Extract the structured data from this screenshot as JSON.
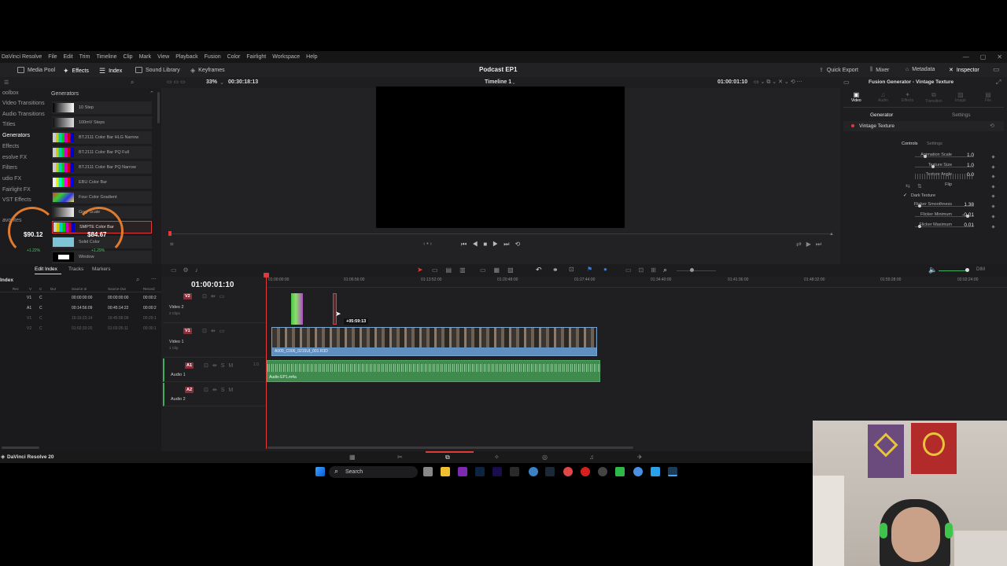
{
  "app": {
    "menu": [
      "DaVinci Resolve",
      "File",
      "Edit",
      "Trim",
      "Timeline",
      "Clip",
      "Mark",
      "View",
      "Playback",
      "Fusion",
      "Color",
      "Fairlight",
      "Workspace",
      "Help"
    ]
  },
  "toolbar": {
    "media_pool": "Media Pool",
    "effects": "Effects",
    "index": "Index",
    "sound_library": "Sound Library",
    "keyframes": "Keyframes",
    "project_title": "Podcast EP1",
    "quick_export": "Quick Export",
    "mixer": "Mixer",
    "metadata": "Metadata",
    "inspector": "Inspector"
  },
  "viewer_bar": {
    "zoom": "33%",
    "duration": "00:30:18:13",
    "timeline_name": "Timeline 1",
    "timecode": "01:00:01:10"
  },
  "effects_panel": {
    "toolbox": [
      "oolbox",
      "Video Transitions",
      "Audio Transitions",
      "Titles",
      "Generators",
      "Effects",
      "esolve FX",
      "Filters",
      "udio FX",
      "Fairlight FX",
      "VST Effects",
      "avorites"
    ],
    "header": "Generators",
    "items": [
      {
        "label": "10 Step"
      },
      {
        "label": "100mV Steps"
      },
      {
        "label": "BT.2111 Color Bar HLG Narrow"
      },
      {
        "label": "BT.2111 Color Bar PQ Full"
      },
      {
        "label": "BT.2111 Color Bar PQ Narrow"
      },
      {
        "label": "EBU Color Bar"
      },
      {
        "label": "Four Color Gradient"
      },
      {
        "label": "Grey Scale"
      },
      {
        "label": "SMPTE Color Bar"
      },
      {
        "label": "Solid Color"
      },
      {
        "label": "Window"
      }
    ]
  },
  "overlay": {
    "price_left": "$90.12",
    "price_right": "$84.67",
    "pct_left": "+1.22%",
    "pct_right": "+1.29%"
  },
  "inspector": {
    "title": "Fusion Generator - Vintage Texture",
    "tabs": [
      "Video",
      "Audio",
      "Effects",
      "Transition",
      "Image",
      "File"
    ],
    "subtabs": [
      "Generator",
      "Settings"
    ],
    "section": "Vintage Texture",
    "section_tabs": [
      "Controls",
      "Settings"
    ],
    "props": [
      {
        "label": "Animation Scale",
        "value": "1.0",
        "level": 0.15
      },
      {
        "label": "Texture Size",
        "value": "1.0",
        "level": 0.3
      },
      {
        "label": "Texture Angle",
        "value": "0.0",
        "level": 0.5
      },
      {
        "label": "Flip",
        "value": ""
      },
      {
        "label": "Dark Texture",
        "value": ""
      },
      {
        "label": "Flicker Smoothness",
        "value": "1.38",
        "level": 0.05
      },
      {
        "label": "Flicker Minimum",
        "value": "-0.01",
        "level": 0.92
      },
      {
        "label": "Flicker Maximum",
        "value": "0.01",
        "level": 0.05
      }
    ]
  },
  "index_panel": {
    "title": "Index",
    "tabs": [
      "Edit Index",
      "Tracks",
      "Markers"
    ],
    "columns": [
      "Rec",
      "V",
      "C",
      "Dur",
      "Source In",
      "Source Out",
      "Record"
    ],
    "rows": [
      {
        "track": "V1",
        "c": "C",
        "src_in": "00:00:00:00",
        "src_out": "00:00:00:00",
        "rec": "00:00:2"
      },
      {
        "track": "A1",
        "c": "C",
        "src_in": "00:14:56:09",
        "src_out": "00:45:14:22",
        "rec": "00:00:2"
      },
      {
        "track": "V1",
        "c": "C",
        "src_in": "16:16:23:14",
        "src_out": "16:45:58:09",
        "rec": "00:29:1"
      },
      {
        "track": "V2",
        "c": "C",
        "src_in": "01:02:33:20",
        "src_out": "01:03:26:11",
        "rec": "00:30:1"
      }
    ]
  },
  "timeline": {
    "current_tc": "01:00:01:10",
    "ruler": [
      "01:00:00:00",
      "01:06:56:00",
      "01:13:52:00",
      "01:20:48:00",
      "01:27:44:00",
      "01:34:40:00",
      "01:41:36:00",
      "01:48:32:00",
      "01:55:28:00",
      "02:02:24:00"
    ],
    "drag_tooltip": "+05:59:13",
    "dim": "DIM",
    "tracks": [
      {
        "id": "V2",
        "name": "Video 2",
        "sub": "2 Clips"
      },
      {
        "id": "V1",
        "name": "Video 1",
        "sub": "1 Clip",
        "clip": "A009_C006_0215UI_001.R3D"
      },
      {
        "id": "A1",
        "name": "Audio 1",
        "level": "1.0",
        "clip": "Audio EP1.m4a"
      },
      {
        "id": "A2",
        "name": "Audio 2"
      }
    ]
  },
  "status": {
    "app_name": "DaVinci Resolve 20"
  },
  "taskbar": {
    "search": "Search"
  },
  "colors": {
    "accent_red": "#e23a3a",
    "video_clip": "#5e8fbf",
    "audio_clip": "#3f8a4d",
    "inspector_orange": "#ff7a2f"
  }
}
